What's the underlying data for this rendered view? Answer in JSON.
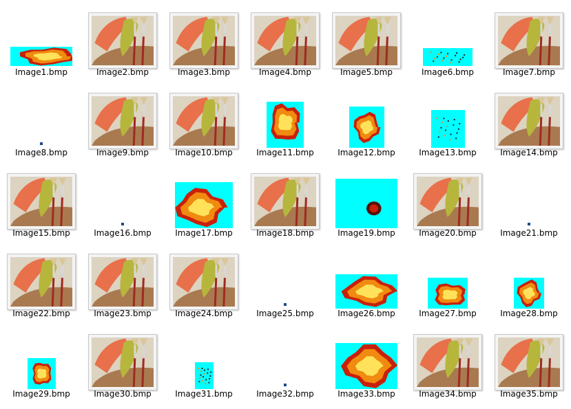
{
  "files": [
    {
      "name": "Image1.bmp",
      "kind": "fire-strip"
    },
    {
      "name": "Image2.bmp",
      "kind": "paint"
    },
    {
      "name": "Image3.bmp",
      "kind": "paint"
    },
    {
      "name": "Image4.bmp",
      "kind": "paint"
    },
    {
      "name": "Image5.bmp",
      "kind": "paint"
    },
    {
      "name": "Image6.bmp",
      "kind": "specks-strip"
    },
    {
      "name": "Image7.bmp",
      "kind": "paint"
    },
    {
      "name": "Image8.bmp",
      "kind": "dot"
    },
    {
      "name": "Image9.bmp",
      "kind": "paint"
    },
    {
      "name": "Image10.bmp",
      "kind": "paint"
    },
    {
      "name": "Image11.bmp",
      "kind": "fire-tall"
    },
    {
      "name": "Image12.bmp",
      "kind": "fire-square"
    },
    {
      "name": "Image13.bmp",
      "kind": "specks-square"
    },
    {
      "name": "Image14.bmp",
      "kind": "paint"
    },
    {
      "name": "Image15.bmp",
      "kind": "paint"
    },
    {
      "name": "Image16.bmp",
      "kind": "dot"
    },
    {
      "name": "Image17.bmp",
      "kind": "explosion"
    },
    {
      "name": "Image18.bmp",
      "kind": "paint"
    },
    {
      "name": "Image19.bmp",
      "kind": "ember"
    },
    {
      "name": "Image20.bmp",
      "kind": "paint"
    },
    {
      "name": "Image21.bmp",
      "kind": "dot"
    },
    {
      "name": "Image22.bmp",
      "kind": "paint"
    },
    {
      "name": "Image23.bmp",
      "kind": "paint"
    },
    {
      "name": "Image24.bmp",
      "kind": "paint"
    },
    {
      "name": "Image25.bmp",
      "kind": "dot"
    },
    {
      "name": "Image26.bmp",
      "kind": "fire-wide"
    },
    {
      "name": "Image27.bmp",
      "kind": "fire-curl"
    },
    {
      "name": "Image28.bmp",
      "kind": "fire-narrow"
    },
    {
      "name": "Image29.bmp",
      "kind": "fire-small"
    },
    {
      "name": "Image30.bmp",
      "kind": "paint"
    },
    {
      "name": "Image31.bmp",
      "kind": "specks-narrow"
    },
    {
      "name": "Image32.bmp",
      "kind": "dot"
    },
    {
      "name": "Image33.bmp",
      "kind": "fire-big"
    },
    {
      "name": "Image34.bmp",
      "kind": "paint"
    },
    {
      "name": "Image35.bmp",
      "kind": "paint"
    }
  ],
  "colors": {
    "cyan": "#00ffff",
    "canvas": "#dcd3c1",
    "orange_paint": "#e8704a",
    "olive_paint": "#b6b63c",
    "wood": "#a06a3c",
    "brush_red": "#9e2a22",
    "fire_yellow": "#ffe25a",
    "fire_orange": "#f08a10",
    "fire_red": "#c8200a",
    "dot_blue": "#1e4a8c"
  }
}
